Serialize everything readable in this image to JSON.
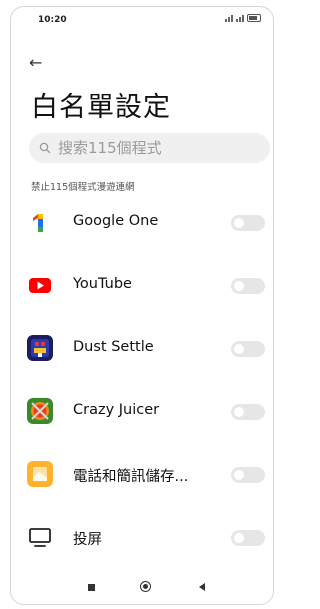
{
  "status_bar": {
    "time": "10:20"
  },
  "header": {
    "title": "白名單設定"
  },
  "search": {
    "placeholder": "搜索115個程式"
  },
  "section": {
    "label": "禁止115個程式漫遊連網"
  },
  "apps": [
    {
      "name": "Google One",
      "icon": "google-one-icon",
      "enabled": false
    },
    {
      "name": "YouTube",
      "icon": "youtube-icon",
      "enabled": false
    },
    {
      "name": "Dust Settle",
      "icon": "dust-settle-icon",
      "enabled": false
    },
    {
      "name": "Crazy Juicer",
      "icon": "crazy-juicer-icon",
      "enabled": false
    },
    {
      "name": "電話和簡訊儲存...",
      "icon": "phone-sms-backup-icon",
      "enabled": false
    },
    {
      "name": "投屏",
      "icon": "screen-cast-icon",
      "enabled": false
    }
  ],
  "colors": {
    "youtube_red": "#ff0000",
    "toggle_off": "#e6e6e6"
  }
}
